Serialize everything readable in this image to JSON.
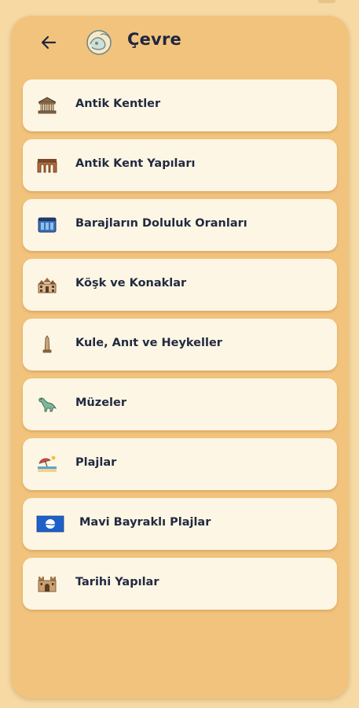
{
  "header": {
    "title": "Çevre",
    "back_icon": "arrow-left-icon",
    "section_icon": "globe-leaf-icon"
  },
  "colors": {
    "page_background": "#f6d9a3",
    "panel_background": "#f2c37c",
    "card_background": "#fdf6e5",
    "text": "#222a40"
  },
  "menu": {
    "items": [
      {
        "label": "Antik Kentler",
        "icon": "ancient-temple-icon"
      },
      {
        "label": "Antik Kent Yapıları",
        "icon": "aqueduct-icon"
      },
      {
        "label": "Barajların Doluluk Oranları",
        "icon": "dam-icon"
      },
      {
        "label": "Köşk ve Konaklar",
        "icon": "mansion-icon"
      },
      {
        "label": "Kule, Anıt ve Heykeller",
        "icon": "obelisk-icon"
      },
      {
        "label": "Müzeler",
        "icon": "dinosaur-icon"
      },
      {
        "label": "Plajlar",
        "icon": "beach-umbrella-icon"
      },
      {
        "label": "Mavi Bayraklı Plajlar",
        "icon": "blue-flag-icon"
      },
      {
        "label": "Tarihi Yapılar",
        "icon": "castle-icon"
      }
    ]
  }
}
